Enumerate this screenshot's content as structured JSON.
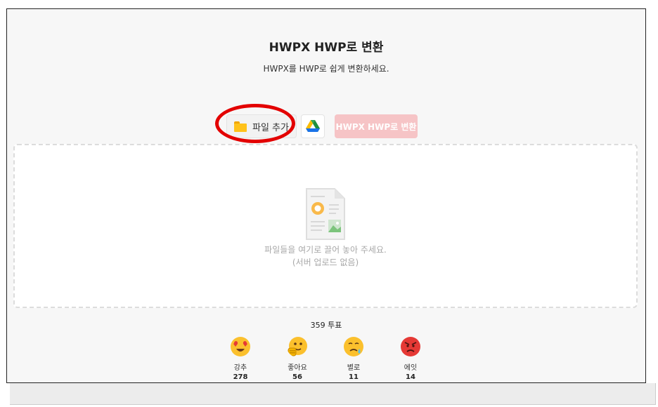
{
  "header": {
    "title": "HWPX HWP로 변환",
    "subtitle": "HWPX를 HWP로 쉽게 변환하세요."
  },
  "toolbar": {
    "add_file_label": "파일 추가",
    "google_drive_icon": "google-drive-icon",
    "convert_label": "HWPX HWP로 변환",
    "convert_color": "#f6c4c6"
  },
  "dropzone": {
    "line1": "파일들을 여기로 끌어 놓아 주세요.",
    "line2": "(서버 업로드 없음)"
  },
  "rating": {
    "total": "359 투표",
    "reactions": [
      {
        "icon": "heart-eyes-icon",
        "label": "강추",
        "count": "278"
      },
      {
        "icon": "thumbs-up-face-icon",
        "label": "좋아요",
        "count": "56"
      },
      {
        "icon": "sad-face-icon",
        "label": "별로",
        "count": "11"
      },
      {
        "icon": "angry-face-icon",
        "label": "에잇",
        "count": "14"
      }
    ]
  },
  "colors": {
    "highlight": "#e30000",
    "background": "#f7f7f7"
  }
}
